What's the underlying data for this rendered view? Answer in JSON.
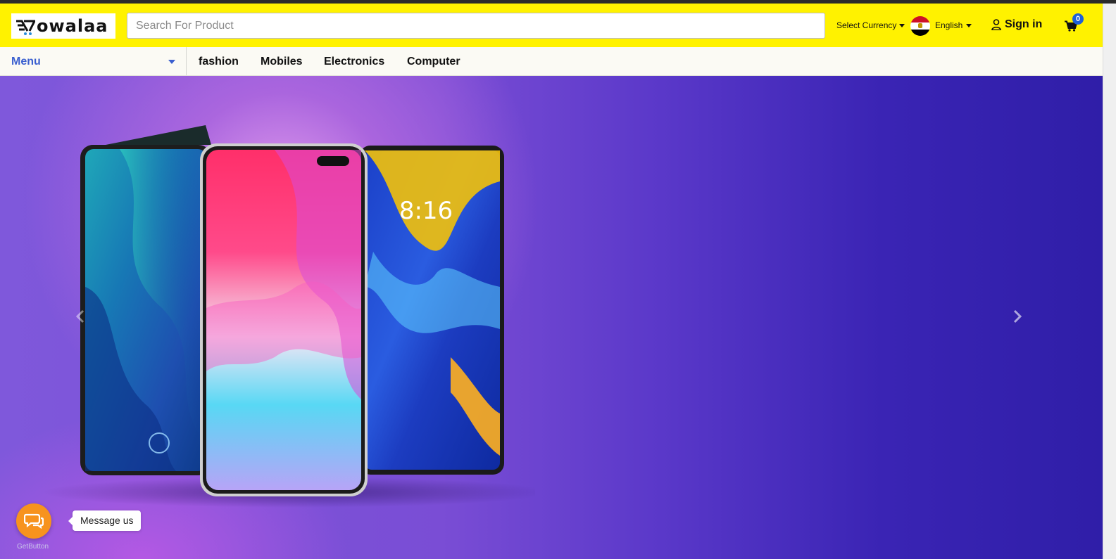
{
  "brand": {
    "logo_text": "owalaa"
  },
  "search": {
    "placeholder": "Search For Product",
    "value": ""
  },
  "header": {
    "currency_label": "Select Currency",
    "language_label": "English",
    "signin_label": "Sign in",
    "cart_count": "0",
    "flag": "egypt-flag"
  },
  "nav": {
    "menu_label": "Menu",
    "links": [
      {
        "label": "fashion"
      },
      {
        "label": "Mobiles"
      },
      {
        "label": "Electronics"
      },
      {
        "label": "Computer"
      }
    ]
  },
  "banner": {
    "phone_clock": "8:16",
    "prev_icon": "chevron-left-icon",
    "next_icon": "chevron-right-icon"
  },
  "chat": {
    "label": "Message us",
    "provider": "GetButton"
  },
  "colors": {
    "header_bg": "#fff200",
    "accent": "#3a5fcf",
    "badge": "#1e5fd8",
    "chat": "#f7931e"
  }
}
